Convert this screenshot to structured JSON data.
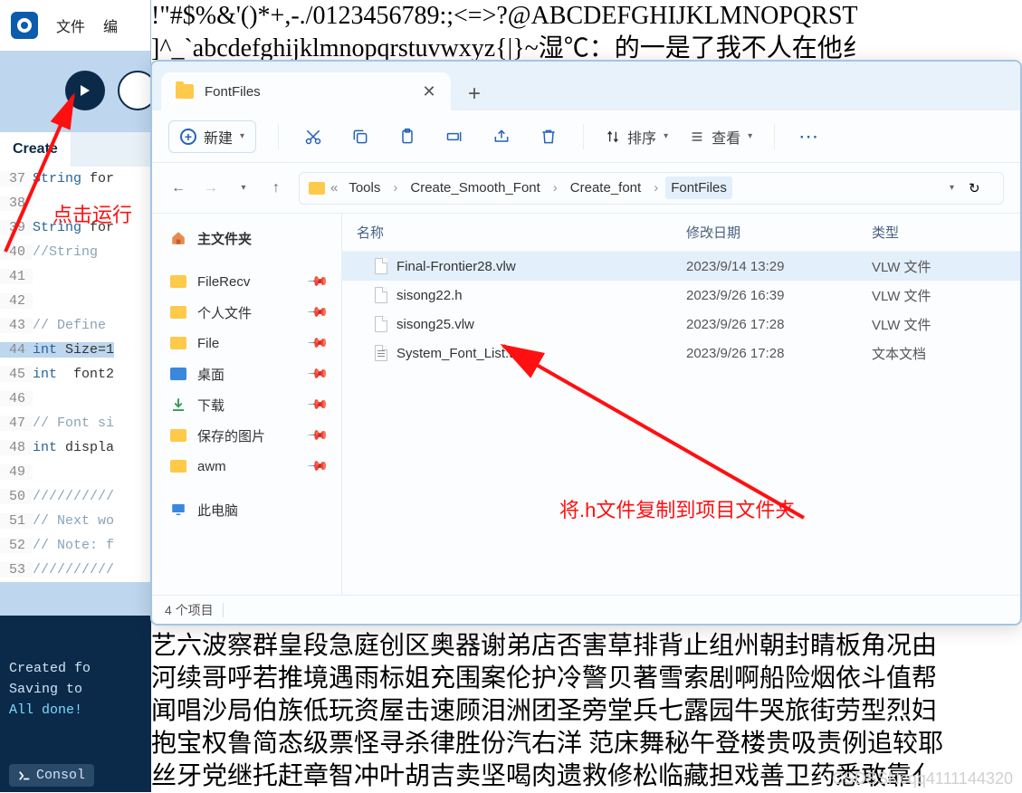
{
  "bg_top_line1": "!\"#$%&'()*+,-./0123456789:;<=>?@ABCDEFGHIJKLMNOPQRST",
  "bg_top_line2": "]^_`abcdefghijklmnopqrstuvwxyz{|}~湿℃：的一是了我不人在他纟",
  "bg_bottom_1": "艺六波察群皇段急庭创区奥器谢弟店否害草排背止组州朝封睛板角况由",
  "bg_bottom_2": "河续哥呼若推境遇雨标姐充围案伦护冷警贝著雪索剧啊船险烟依斗值帮",
  "bg_bottom_3": "闻唱沙局伯族低玩资屋击速顾泪洲团圣旁堂兵七露园牛哭旅街劳型烈妇",
  "bg_bottom_4": "抱宝权鲁简态级票怪寻杀律胜份汽右洋 范床舞秘午登楼贵吸责例追较耶",
  "bg_bottom_5": "丝牙党继托赶章智冲叶胡吉卖坚喝肉遗救修松临藏担戏善卫药悉敢靠亻",
  "ide": {
    "menu_file": "文件",
    "menu_edit": "编",
    "tab": "Create",
    "lines": [
      {
        "n": "37",
        "html": "<span class='kw-str'>String</span> for"
      },
      {
        "n": "38",
        "html": ""
      },
      {
        "n": "39",
        "html": "<span class='kw-str'>String</span> for"
      },
      {
        "n": "40",
        "html": "<span class='cm'>//String </span>"
      },
      {
        "n": "41",
        "html": ""
      },
      {
        "n": "42",
        "html": ""
      },
      {
        "n": "43",
        "html": "<span class='cm'>// Define</span>"
      },
      {
        "n": "44",
        "html": "<span class='kw-int'>int</span> Size=1",
        "current": true
      },
      {
        "n": "45",
        "html": "<span class='kw-int'>int</span>  font2"
      },
      {
        "n": "46",
        "html": ""
      },
      {
        "n": "47",
        "html": "<span class='cm'>// Font si</span>"
      },
      {
        "n": "48",
        "html": "<span class='kw-int'>int</span> displa"
      },
      {
        "n": "49",
        "html": ""
      },
      {
        "n": "50",
        "html": "<span class='cm'>//////////</span>"
      },
      {
        "n": "51",
        "html": "<span class='cm'>// Next wo</span>"
      },
      {
        "n": "52",
        "html": "<span class='cm'>// Note: f</span>"
      },
      {
        "n": "53",
        "html": "<span class='cm'>//////////</span>"
      }
    ],
    "console_l1": "Created fo",
    "console_l2": "Saving to",
    "console_done": "All done!",
    "console_tab": "Consol"
  },
  "annotations": {
    "run": "点击运行",
    "copy": "将.h文件复制到项目文件夹"
  },
  "explorer": {
    "tab_title": "FontFiles",
    "toolbar": {
      "new": "新建",
      "sort": "排序",
      "view": "查看"
    },
    "breadcrumbs": [
      "Tools",
      "Create_Smooth_Font",
      "Create_font",
      "FontFiles"
    ],
    "sidebar": {
      "home": "主文件夹",
      "items": [
        "FileRecv",
        "个人文件",
        "File"
      ],
      "desktop": "桌面",
      "downloads": "下载",
      "pictures": "保存的图片",
      "awm": "awm",
      "thispc": "此电脑"
    },
    "columns": {
      "name": "名称",
      "date": "修改日期",
      "type": "类型"
    },
    "files": [
      {
        "name": "Final-Frontier28.vlw",
        "date": "2023/9/14 13:29",
        "type": "VLW 文件",
        "sel": true
      },
      {
        "name": "sisong22.h",
        "date": "2023/9/26 16:39",
        "type": "VLW 文件"
      },
      {
        "name": "sisong25.vlw",
        "date": "2023/9/26 17:28",
        "type": "VLW 文件"
      },
      {
        "name": "System_Font_List.txt",
        "date": "2023/9/26 17:28",
        "type": "文本文档",
        "txt": true
      }
    ],
    "status": "4 个项目"
  },
  "watermark": "CSDSSNcqq4111144320"
}
